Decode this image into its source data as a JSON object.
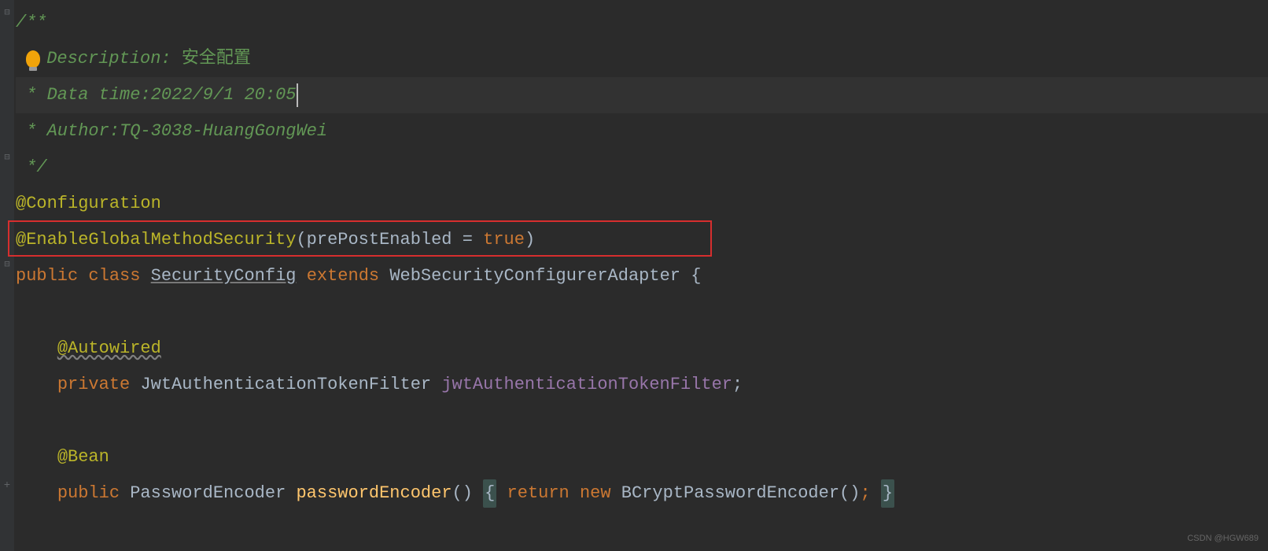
{
  "comment": {
    "open": "/**",
    "description_label": "Description:",
    "description_value": "安全配置",
    "datetime_label": "Data time:",
    "datetime_value": "2022/9/1 20:05",
    "author_label": "Author:",
    "author_value": "TQ-3038-HuangGongWei",
    "close": "*/"
  },
  "annotations": {
    "configuration": "@Configuration",
    "enable_global": "@EnableGlobalMethodSecurity",
    "paren_open": "(",
    "param_name": "prePostEnabled",
    "equals": " = ",
    "param_value": "true",
    "paren_close": ")",
    "autowired": "@Autowired",
    "bean": "@Bean"
  },
  "class_decl": {
    "public": "public",
    "class_kw": "class",
    "name": "SecurityConfig",
    "extends_kw": "extends",
    "parent": "WebSecurityConfigurerAdapter",
    "brace": "{"
  },
  "field_decl": {
    "private": "private",
    "type": "JwtAuthenticationTokenFilter",
    "name": "jwtAuthenticationTokenFilter",
    "semi": ";"
  },
  "method_decl": {
    "public": "public",
    "return_type": "PasswordEncoder",
    "name": "passwordEncoder",
    "parens": "()",
    "brace_open": "{",
    "return_kw": "return",
    "new_kw": "new",
    "ctor": "BCryptPasswordEncoder",
    "ctor_parens": "()",
    "semi": ";",
    "brace_close": "}"
  },
  "watermark": "CSDN @HGW689"
}
